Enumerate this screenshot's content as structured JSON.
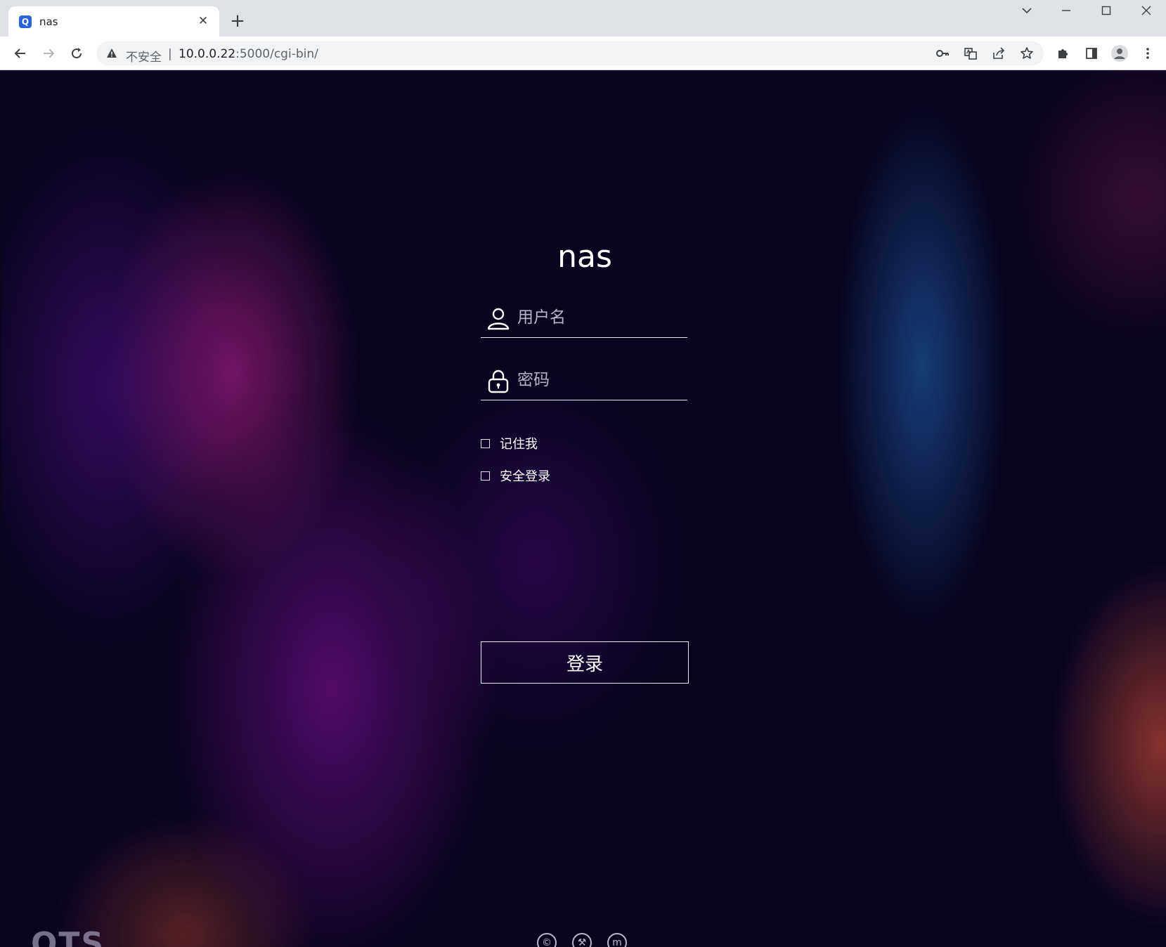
{
  "browser": {
    "tab": {
      "title": "nas",
      "favicon_glyph": "Q",
      "close_glyph": "✕"
    },
    "new_tab_glyph": "+",
    "address_bar": {
      "security_label": "不安全",
      "separator": "|",
      "url_host": "10.0.0.22",
      "url_path": ":5000/cgi-bin/"
    }
  },
  "login": {
    "title": "nas",
    "username_placeholder": "用户名",
    "password_placeholder": "密码",
    "remember_me_label": "记住我",
    "secure_login_label": "安全登录",
    "submit_label": "登录"
  },
  "footer": {
    "logo_text": "QTS",
    "icon_glyphs": [
      "©",
      "⚒",
      "m"
    ]
  },
  "icons": {
    "username_field": "user-icon",
    "password_field": "lock-icon",
    "footer": [
      "copyright-icon",
      "tool-icon",
      "m-icon"
    ]
  },
  "colors": {
    "accent": "#ffffff",
    "tab_favicon": "#2b63d9",
    "background_dark": "#080420"
  }
}
